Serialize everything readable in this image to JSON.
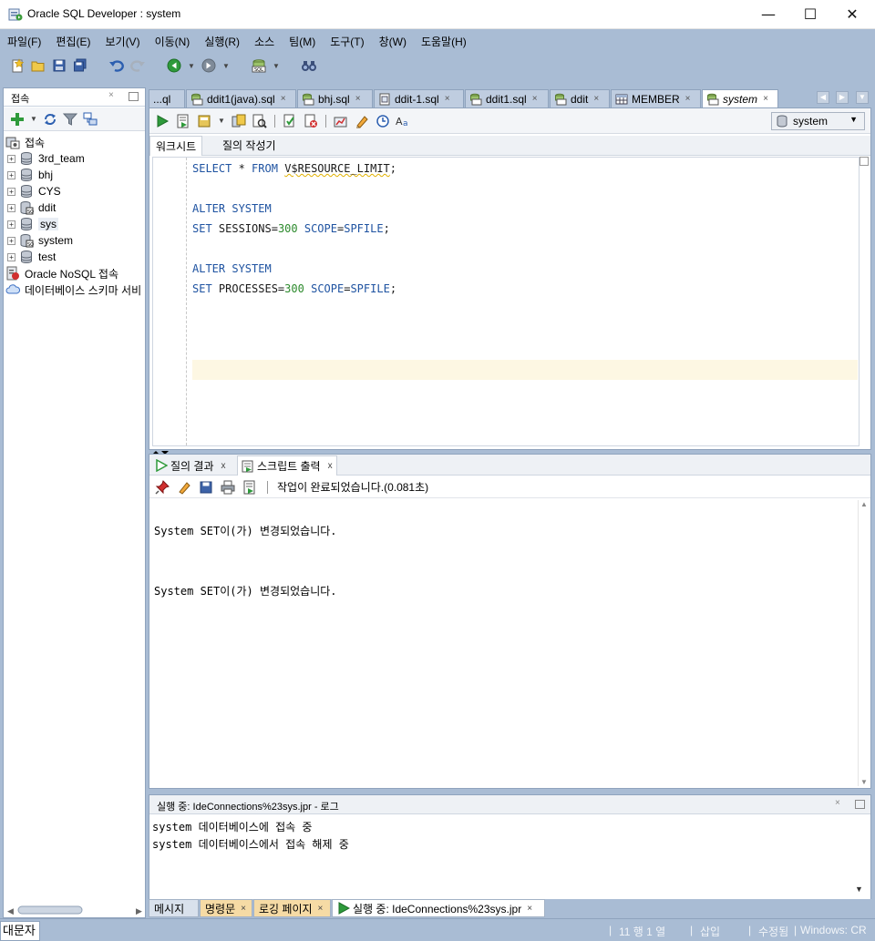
{
  "window": {
    "title": "Oracle SQL Developer : system",
    "minimize": "—",
    "maximize": "☐",
    "close": "✕"
  },
  "menu": [
    "파일(F)",
    "편집(E)",
    "보기(V)",
    "이동(N)",
    "실행(R)",
    "소스",
    "팀(M)",
    "도구(T)",
    "창(W)",
    "도움말(H)"
  ],
  "connections_panel": {
    "tab_label": "접속",
    "close": "×",
    "root_label": "접속",
    "items": [
      "3rd_team",
      "bhj",
      "CYS",
      "ddit",
      "sys",
      "system",
      "test"
    ],
    "nosql_label": "Oracle NoSQL 접속",
    "schema_label": "데이터베이스 스키마 서비"
  },
  "editor_tabs": [
    {
      "label": "...ql"
    },
    {
      "label": "ddit1(java).sql"
    },
    {
      "label": "bhj.sql"
    },
    {
      "label": "ddit-1.sql"
    },
    {
      "label": "ddit1.sql"
    },
    {
      "label": "ddit"
    },
    {
      "label": "MEMBER"
    },
    {
      "label": "system"
    }
  ],
  "tab_close": "×",
  "editor": {
    "connection": "system",
    "subtabs": {
      "worksheet": "워크시트",
      "query_builder": "질의 작성기"
    },
    "code": {
      "l1": {
        "kw1": "SELECT",
        "a": " * ",
        "kw2": "FROM",
        "b": " ",
        "c": "V$RESOURCE_LIMIT",
        "d": ";"
      },
      "l3": {
        "kw1": "ALTER",
        "a": " ",
        "kw2": "SYSTEM"
      },
      "l4": {
        "kw1": "SET",
        "a": " SESSIONS=",
        "n": "300",
        "b": " ",
        "kw2": "SCOPE",
        "c": "=",
        "kw3": "SPFILE",
        "d": ";"
      },
      "l6": {
        "kw1": "ALTER",
        "a": " ",
        "kw2": "SYSTEM"
      },
      "l7": {
        "kw1": "SET",
        "a": " PROCESSES=",
        "n": "300",
        "b": " ",
        "kw2": "SCOPE",
        "c": "=",
        "kw3": "SPFILE",
        "d": ";"
      }
    }
  },
  "results": {
    "tab_query_result": "질의 결과",
    "tab_script_output": "스크립트 출력",
    "close": "x",
    "status": "작업이 완료되었습니다.(0.081초)",
    "lines": [
      "System SET이(가) 변경되었습니다.",
      "System SET이(가) 변경되었습니다."
    ]
  },
  "log": {
    "title": "실행 중: IdeConnections%23sys.jpr - 로그",
    "close": "×",
    "lines": [
      "system 데이터베이스에 접속 중",
      "system 데이터베이스에서 접속 해제 중"
    ]
  },
  "bottom_tabs": {
    "messages": "메시지",
    "statements": "명령문",
    "logging": "로깅 페이지",
    "running": "실행 중: IdeConnections%23sys.jpr",
    "close": "×"
  },
  "statusbar": {
    "ime": "대문자",
    "position": "11 행 1 열",
    "insert": "삽입",
    "modified": "수정됨",
    "eol": "Windows: CR"
  },
  "colors": {
    "chrome": "#a9bcd4",
    "keyword": "#1f53a1",
    "number": "#2c8a2c",
    "current_line": "#fdf7e3"
  }
}
